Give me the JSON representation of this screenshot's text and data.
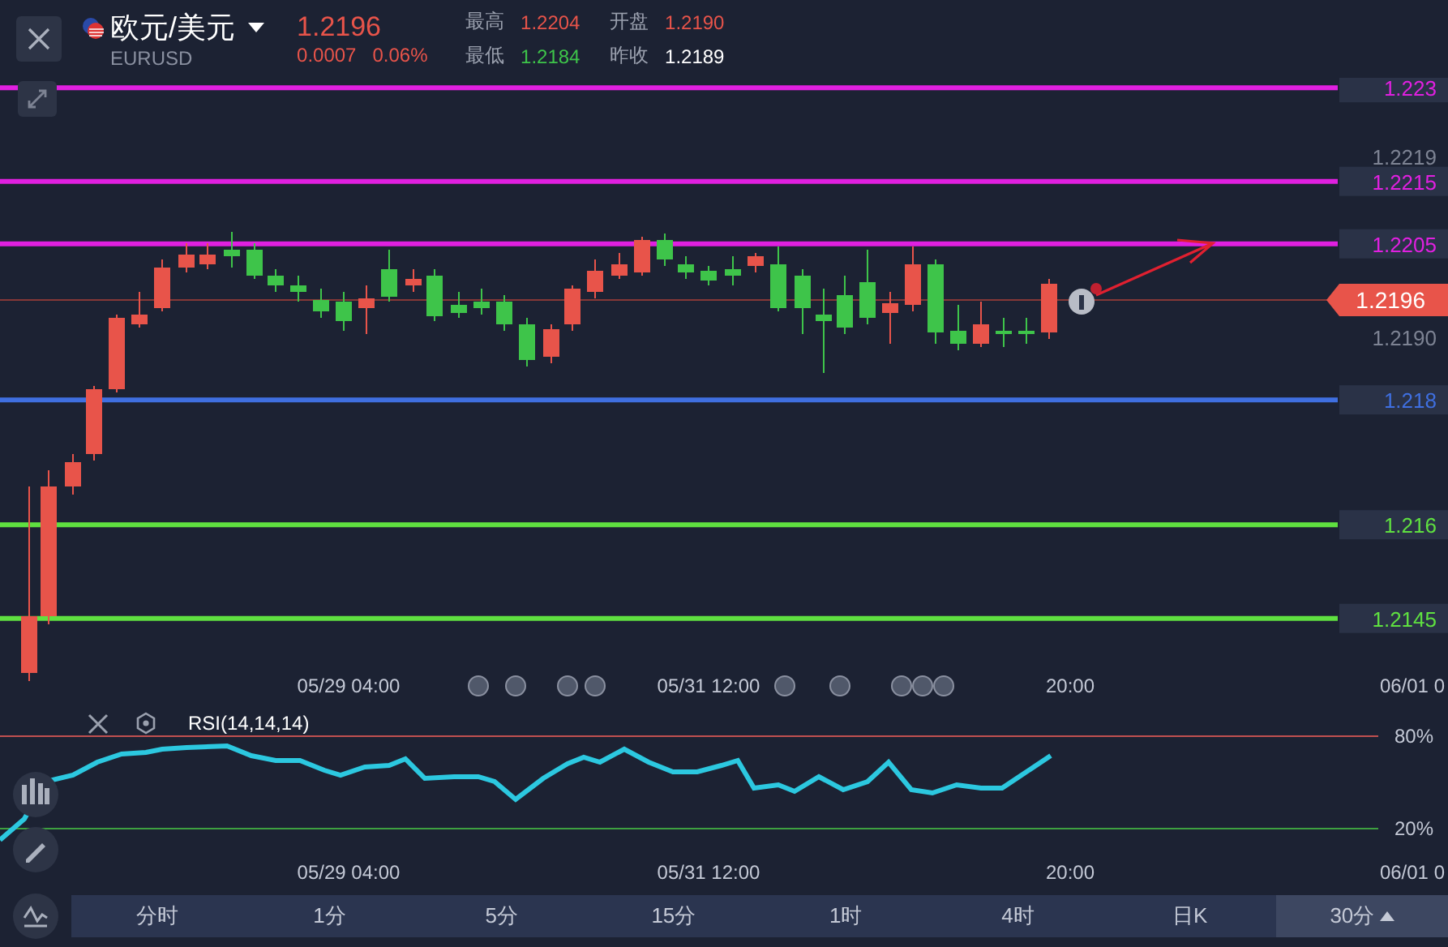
{
  "header": {
    "symbol": "欧元/美元",
    "code": "EURUSD",
    "price": "1.2196",
    "change": "0.0007",
    "change_pct": "0.06%",
    "stats": [
      {
        "label": "最高",
        "value": "1.2204",
        "color": "#e8544a"
      },
      {
        "label": "开盘",
        "value": "1.2190",
        "color": "#e8544a"
      },
      {
        "label": "最低",
        "value": "1.2184",
        "color": "#3ec44a"
      },
      {
        "label": "昨收",
        "value": "1.2189",
        "color": "#ffffff"
      }
    ]
  },
  "chart": {
    "levels": [
      {
        "price": "1.223",
        "color": "#e020e0"
      },
      {
        "price": "1.2215",
        "color": "#e020e0"
      },
      {
        "price": "1.2205",
        "color": "#e020e0"
      },
      {
        "price": "1.218",
        "color": "#3f6fe0"
      },
      {
        "price": "1.216",
        "color": "#5fe040"
      },
      {
        "price": "1.2145",
        "color": "#5fe040"
      }
    ],
    "axis_labels": [
      "1.2219",
      "1.2190"
    ],
    "current_price": "1.2196",
    "time_labels": [
      "05/29 04:00",
      "05/31 12:00",
      "20:00",
      "06/01 0"
    ]
  },
  "rsi": {
    "title": "RSI(14,14,14)",
    "upper": "80%",
    "lower": "20%",
    "time_labels": [
      "05/29 04:00",
      "05/31 12:00",
      "20:00",
      "06/01 0"
    ]
  },
  "timeframes": [
    {
      "label": "分时",
      "selected": false
    },
    {
      "label": "1分",
      "selected": false
    },
    {
      "label": "5分",
      "selected": false
    },
    {
      "label": "15分",
      "selected": false
    },
    {
      "label": "1时",
      "selected": false
    },
    {
      "label": "4时",
      "selected": false
    },
    {
      "label": "日K",
      "selected": false
    },
    {
      "label": "30分",
      "selected": true
    }
  ]
}
